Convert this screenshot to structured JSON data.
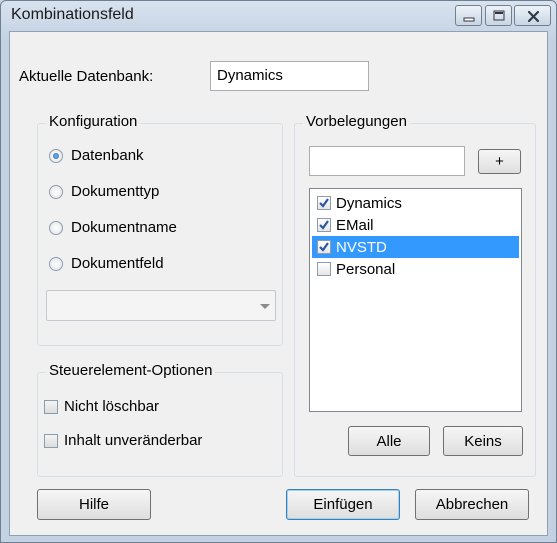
{
  "window": {
    "title": "Kombinationsfeld"
  },
  "current_db": {
    "label": "Aktuelle Datenbank:",
    "value": "Dynamics"
  },
  "configuration": {
    "title": "Konfiguration",
    "options": [
      {
        "label": "Datenbank",
        "selected": true
      },
      {
        "label": "Dokumenttyp",
        "selected": false
      },
      {
        "label": "Dokumentname",
        "selected": false
      },
      {
        "label": "Dokumentfeld",
        "selected": false
      }
    ],
    "combo_value": ""
  },
  "control_options": {
    "title": "Steuerelement-Optionen",
    "items": [
      {
        "label": "Nicht löschbar",
        "checked": false
      },
      {
        "label": "Inhalt unveränderbar",
        "checked": false
      }
    ]
  },
  "presets": {
    "title": "Vorbelegungen",
    "input_value": "",
    "add_label": "+",
    "items": [
      {
        "label": "Dynamics",
        "checked": true,
        "selected": false
      },
      {
        "label": "EMail",
        "checked": true,
        "selected": false
      },
      {
        "label": "NVSTD",
        "checked": true,
        "selected": true
      },
      {
        "label": "Personal",
        "checked": false,
        "selected": false
      }
    ],
    "all_label": "Alle",
    "none_label": "Keins"
  },
  "footer": {
    "help_label": "Hilfe",
    "insert_label": "Einfügen",
    "cancel_label": "Abbrechen"
  },
  "colors": {
    "selection": "#3399ff",
    "check": "#2a57a8"
  }
}
